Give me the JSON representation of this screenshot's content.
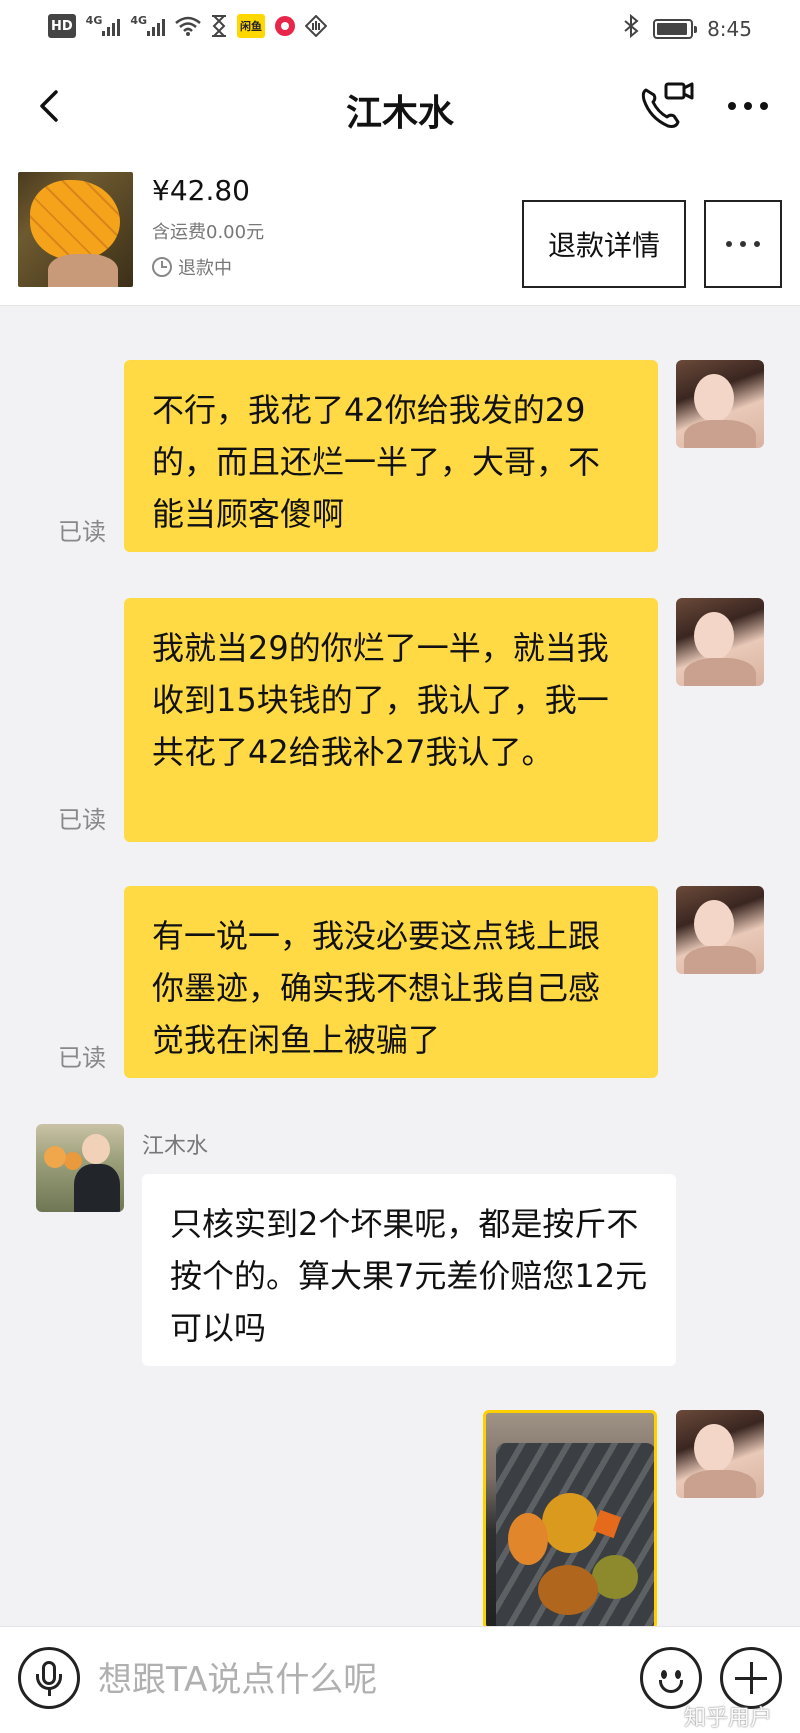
{
  "status_bar": {
    "hd": "HD",
    "net1": "4G",
    "net2": "4G",
    "xianyu_app": "闲鱼",
    "time": "8:45"
  },
  "nav": {
    "title": "江木水"
  },
  "product": {
    "price": "¥42.80",
    "shipping": "含运费0.00元",
    "status": "退款中",
    "refund_button": "退款详情"
  },
  "chat": {
    "read_label": "已读",
    "messages": [
      {
        "from": "me",
        "text": "不行，我花了42你给我发的29的，而且还烂一半了，大哥，不能当顾客傻啊"
      },
      {
        "from": "me",
        "text": "我就当29的你烂了一半，就当我收到15块钱的了，我认了，我一共花了42给我补27我认了。"
      },
      {
        "from": "me",
        "text": "有一说一，我没必要这点钱上跟你墨迹，确实我不想让我自己感觉我在闲鱼上被骗了"
      },
      {
        "from": "them",
        "sender": "江木水",
        "text": "只核实到2个坏果呢，都是按斤不按个的。算大果7元差价赔您12元可以吗"
      }
    ]
  },
  "input": {
    "placeholder": "想跟TA说点什么呢"
  },
  "watermark": "知乎用户"
}
